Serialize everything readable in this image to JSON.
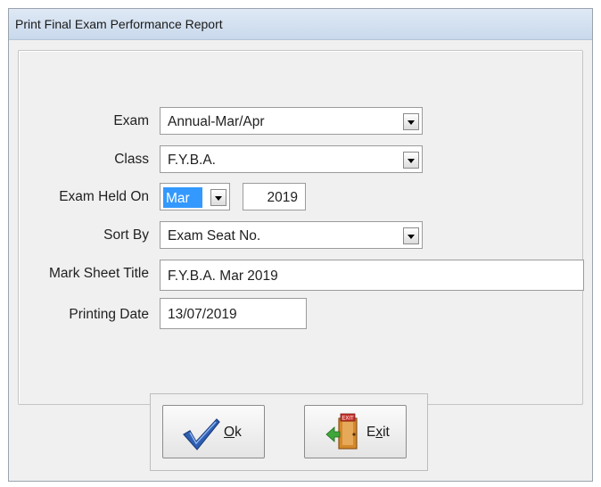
{
  "window": {
    "title": "Print Final Exam Performance Report"
  },
  "form": {
    "exam": {
      "label": "Exam",
      "value": "Annual-Mar/Apr"
    },
    "class": {
      "label": "Class",
      "value": "F.Y.B.A."
    },
    "exam_held_on": {
      "label": "Exam Held On",
      "month": "Mar",
      "year": "2019"
    },
    "sort_by": {
      "label": "Sort By",
      "value": "Exam Seat No."
    },
    "mark_sheet_title": {
      "label": "Mark Sheet Title",
      "value": "F.Y.B.A. Mar 2019"
    },
    "printing_date": {
      "label": "Printing Date",
      "value": "13/07/2019"
    }
  },
  "buttons": {
    "ok": {
      "mnemonic": "O",
      "rest": "k",
      "icon": "checkmark-icon"
    },
    "exit": {
      "prefix": "E",
      "mnemonic": "x",
      "rest": "it",
      "icon": "exit-door-icon",
      "sign_text": "EXIT"
    }
  },
  "colors": {
    "selection": "#3399ff",
    "check": "#2f5fb3",
    "door": "#d4892a",
    "arrow": "#3fa63a"
  }
}
